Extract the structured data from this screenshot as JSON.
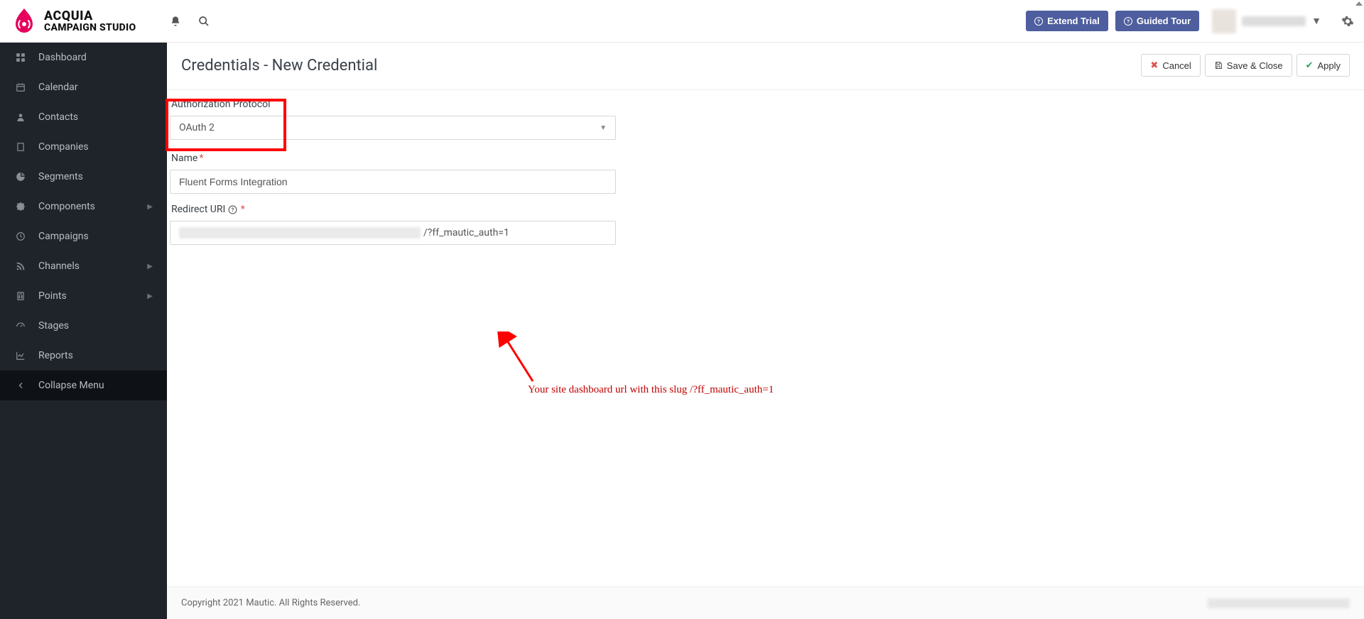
{
  "brand": {
    "top": "ACQUIA",
    "bottom": "CAMPAIGN STUDIO"
  },
  "header": {
    "extend_trial": "Extend Trial",
    "guided_tour": "Guided Tour"
  },
  "sidebar": {
    "items": [
      {
        "label": "Dashboard",
        "icon": "dashboard",
        "expandable": false
      },
      {
        "label": "Calendar",
        "icon": "calendar",
        "expandable": false
      },
      {
        "label": "Contacts",
        "icon": "user",
        "expandable": false
      },
      {
        "label": "Companies",
        "icon": "building",
        "expandable": false
      },
      {
        "label": "Segments",
        "icon": "piechart",
        "expandable": false
      },
      {
        "label": "Components",
        "icon": "puzzle",
        "expandable": true
      },
      {
        "label": "Campaigns",
        "icon": "clock",
        "expandable": false
      },
      {
        "label": "Channels",
        "icon": "rss",
        "expandable": true
      },
      {
        "label": "Points",
        "icon": "calc",
        "expandable": true
      },
      {
        "label": "Stages",
        "icon": "gauge",
        "expandable": false
      },
      {
        "label": "Reports",
        "icon": "chart",
        "expandable": false
      }
    ],
    "collapse": "Collapse Menu"
  },
  "page": {
    "title": "Credentials - New Credential",
    "cancel": "Cancel",
    "save_close": "Save & Close",
    "apply": "Apply"
  },
  "form": {
    "auth_label": "Authorization Protocol",
    "auth_value": "OAuth 2",
    "name_label": "Name",
    "name_value": "Fluent Forms Integration",
    "redirect_label": "Redirect URI",
    "redirect_suffix": "/?ff_mautic_auth=1"
  },
  "annotation": "Your site dashboard url with this slug /?ff_mautic_auth=1",
  "footer": "Copyright 2021 Mautic. All Rights Reserved."
}
